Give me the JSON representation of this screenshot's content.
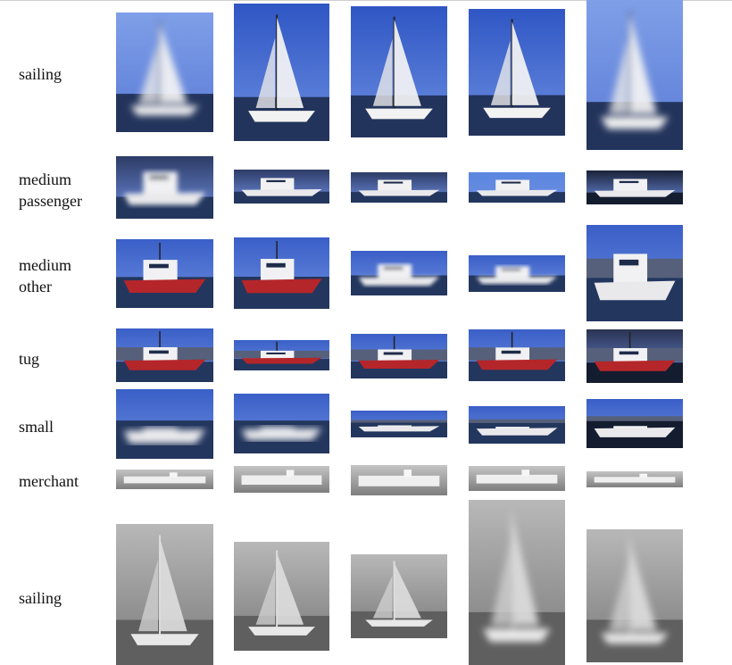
{
  "rows": [
    {
      "label": "sailing",
      "kind": "sail",
      "palette": "rgb"
    },
    {
      "label": "medium\npassenger",
      "kind": "passenger",
      "palette": "rgb"
    },
    {
      "label": "medium\nother",
      "kind": "other",
      "palette": "rgb"
    },
    {
      "label": "tug",
      "kind": "tug",
      "palette": "rgb"
    },
    {
      "label": "small",
      "kind": "small",
      "palette": "rgb"
    },
    {
      "label": "merchant",
      "kind": "merchant",
      "palette": "ir"
    },
    {
      "label": "sailing",
      "kind": "sail",
      "palette": "ir"
    }
  ],
  "colors": {
    "sky": "#3f63c9",
    "sky_light": "#6f8fe0",
    "water_dark": "#1c2a4a",
    "hull_white": "#f2f2f2",
    "hull_red": "#b5262a",
    "ir_bg": "#8a8a8a",
    "ir_light": "#e8e8e8"
  }
}
